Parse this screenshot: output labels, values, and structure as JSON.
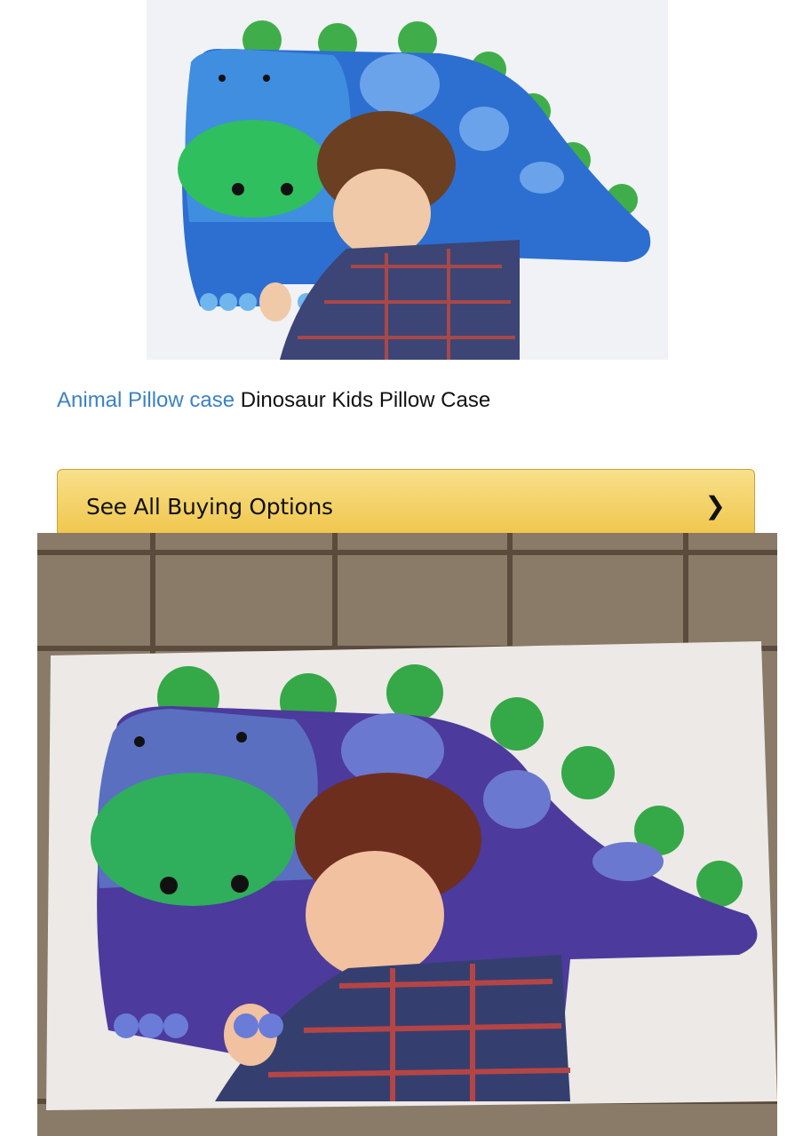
{
  "product": {
    "image_alt": "Dinosaur pillow product photo",
    "title_link": "Animal Pillow case",
    "title_rest": " Dinosaur Kids Pillow Case"
  },
  "buy_button": {
    "label": "See All Buying Options",
    "icon": "chevron-right-icon"
  },
  "colors": {
    "link": "#3b82c4",
    "button": "#f2cb55",
    "dino_body": "#2a6fd1",
    "dino_belly": "#2fbf6a",
    "spikes": "#3fb24f"
  }
}
